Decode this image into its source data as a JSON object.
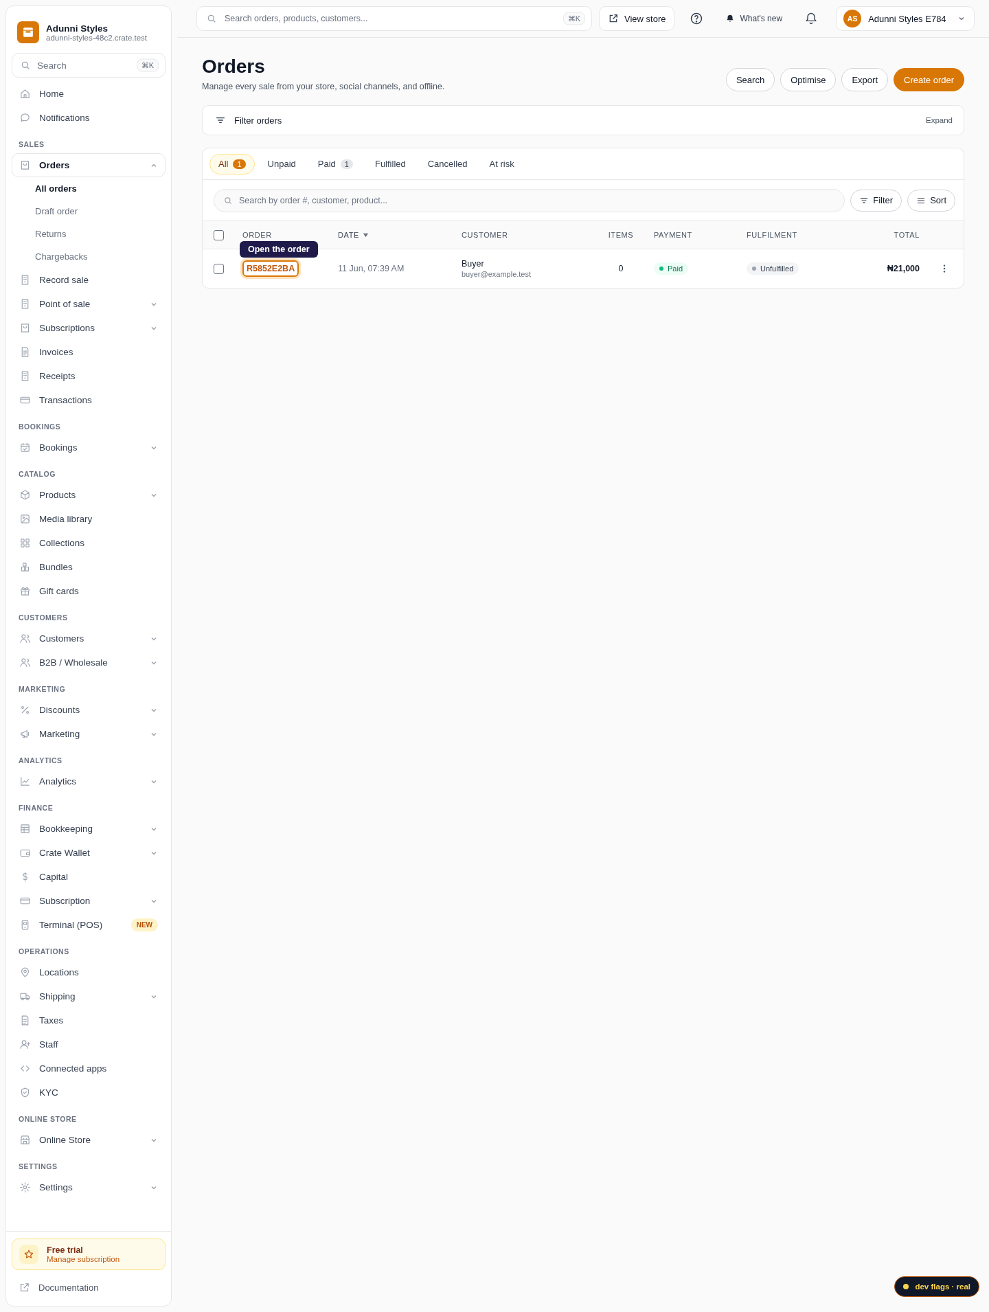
{
  "store": {
    "name": "Adunni Styles",
    "domain": "adunni-styles-48c2.crate.test"
  },
  "sidebar": {
    "search": {
      "placeholder": "Search",
      "shortcut": "⌘K"
    },
    "sections": [
      {
        "items": [
          {
            "label": "Home",
            "kind": "link",
            "selected": false
          },
          {
            "label": "Notifications",
            "kind": "link",
            "selected": false
          }
        ]
      },
      {
        "heading": "SALES",
        "items": [
          {
            "label": "Orders",
            "kind": "group",
            "expanded": true,
            "selected": true,
            "children": [
              {
                "label": "All orders",
                "selected": true
              },
              {
                "label": "Draft order",
                "selected": false
              },
              {
                "label": "Returns",
                "selected": false
              },
              {
                "label": "Chargebacks",
                "selected": false
              }
            ]
          },
          {
            "label": "Record sale",
            "kind": "link",
            "selected": false
          },
          {
            "label": "Point of sale",
            "kind": "group",
            "expanded": false,
            "selected": false
          },
          {
            "label": "Subscriptions",
            "kind": "group",
            "expanded": false,
            "selected": false
          },
          {
            "label": "Invoices",
            "kind": "link",
            "selected": false
          },
          {
            "label": "Receipts",
            "kind": "link",
            "selected": false
          },
          {
            "label": "Transactions",
            "kind": "link",
            "selected": false
          }
        ]
      },
      {
        "heading": "BOOKINGS",
        "items": [
          {
            "label": "Bookings",
            "kind": "group",
            "expanded": false,
            "selected": false
          }
        ]
      },
      {
        "heading": "CATALOG",
        "items": [
          {
            "label": "Products",
            "kind": "group",
            "expanded": false,
            "selected": false
          },
          {
            "label": "Media library",
            "kind": "link",
            "selected": false
          },
          {
            "label": "Collections",
            "kind": "link",
            "selected": false
          },
          {
            "label": "Bundles",
            "kind": "link",
            "selected": false
          },
          {
            "label": "Gift cards",
            "kind": "link",
            "selected": false
          }
        ]
      },
      {
        "heading": "CUSTOMERS",
        "items": [
          {
            "label": "Customers",
            "kind": "group",
            "expanded": false,
            "selected": false
          },
          {
            "label": "B2B / Wholesale",
            "kind": "group",
            "expanded": false,
            "selected": false
          }
        ]
      },
      {
        "heading": "MARKETING",
        "items": [
          {
            "label": "Discounts",
            "kind": "group",
            "expanded": false,
            "selected": false
          },
          {
            "label": "Marketing",
            "kind": "group",
            "expanded": false,
            "selected": false
          }
        ]
      },
      {
        "heading": "ANALYTICS",
        "items": [
          {
            "label": "Analytics",
            "kind": "group",
            "expanded": false,
            "selected": false
          }
        ]
      },
      {
        "heading": "FINANCE",
        "items": [
          {
            "label": "Bookkeeping",
            "kind": "group",
            "expanded": false,
            "selected": false
          },
          {
            "label": "Crate Wallet",
            "kind": "group",
            "expanded": false,
            "selected": false
          },
          {
            "label": "Capital",
            "kind": "link",
            "selected": false
          },
          {
            "label": "Subscription",
            "kind": "group",
            "expanded": false,
            "selected": false
          },
          {
            "label": "Terminal (POS)",
            "kind": "link",
            "selected": false,
            "badge": "NEW"
          }
        ]
      },
      {
        "heading": "OPERATIONS",
        "items": [
          {
            "label": "Locations",
            "kind": "link",
            "selected": false
          },
          {
            "label": "Shipping",
            "kind": "group",
            "expanded": false,
            "selected": false
          },
          {
            "label": "Taxes",
            "kind": "link",
            "selected": false
          },
          {
            "label": "Staff",
            "kind": "link",
            "selected": false
          },
          {
            "label": "Connected apps",
            "kind": "link",
            "selected": false
          },
          {
            "label": "KYC",
            "kind": "link",
            "selected": false
          }
        ]
      },
      {
        "heading": "ONLINE STORE",
        "items": [
          {
            "label": "Online Store",
            "kind": "group",
            "expanded": false,
            "selected": false
          }
        ]
      },
      {
        "heading": "SETTINGS",
        "items": [
          {
            "label": "Settings",
            "kind": "group",
            "expanded": false,
            "selected": false
          }
        ]
      }
    ],
    "trial": {
      "title": "Free trial",
      "link": "Manage subscription"
    },
    "documentation": "Documentation"
  },
  "topbar": {
    "search": {
      "placeholder": "Search orders, products, customers...",
      "shortcut": "⌘K"
    },
    "view_store": "View store",
    "whats_new": "What's new",
    "account": {
      "initials": "AS",
      "name": "Adunni Styles E784"
    }
  },
  "page": {
    "title": "Orders",
    "subtitle": "Manage every sale from your store, social channels, and offline.",
    "actions": [
      {
        "label": "Search",
        "kind": "secondary"
      },
      {
        "label": "Optimise",
        "kind": "secondary"
      },
      {
        "label": "Export",
        "kind": "secondary"
      },
      {
        "label": "Create order",
        "kind": "primary"
      }
    ]
  },
  "filter_bar": {
    "label": "Filter orders",
    "toggle": "Expand"
  },
  "tabs": [
    {
      "label": "All",
      "count": "1",
      "selected": true
    },
    {
      "label": "Unpaid",
      "selected": false
    },
    {
      "label": "Paid",
      "count": "1",
      "selected": false
    },
    {
      "label": "Fulfilled",
      "selected": false
    },
    {
      "label": "Cancelled",
      "selected": false
    },
    {
      "label": "At risk",
      "selected": false
    }
  ],
  "table_search": {
    "placeholder": "Search by order #, customer, product..."
  },
  "filter_button": "Filter",
  "sort_button": "Sort",
  "table": {
    "select_all": {
      "checked": false
    },
    "columns": [
      {
        "label": "ORDER",
        "sorted": false
      },
      {
        "label": "DATE",
        "sorted": true
      },
      {
        "label": "CUSTOMER",
        "sorted": false
      },
      {
        "label": "ITEMS",
        "sorted": false
      },
      {
        "label": "PAYMENT",
        "sorted": false
      },
      {
        "label": "FULFILMENT",
        "sorted": false
      },
      {
        "label": "TOTAL",
        "sorted": false
      }
    ],
    "rows": [
      {
        "checked": false,
        "order": "R5852E2BA",
        "focused": true,
        "date": "11 Jun, 07:39 AM",
        "customer": "Buyer",
        "email": "buyer@example.test",
        "items": "0",
        "payment": {
          "label": "Paid",
          "kind": "success"
        },
        "fulfilment": {
          "label": "Unfulfilled",
          "kind": "neutral"
        },
        "total": "₦21,000"
      }
    ],
    "tooltip": "Open the order"
  },
  "dev_badge": "dev flags · real"
}
